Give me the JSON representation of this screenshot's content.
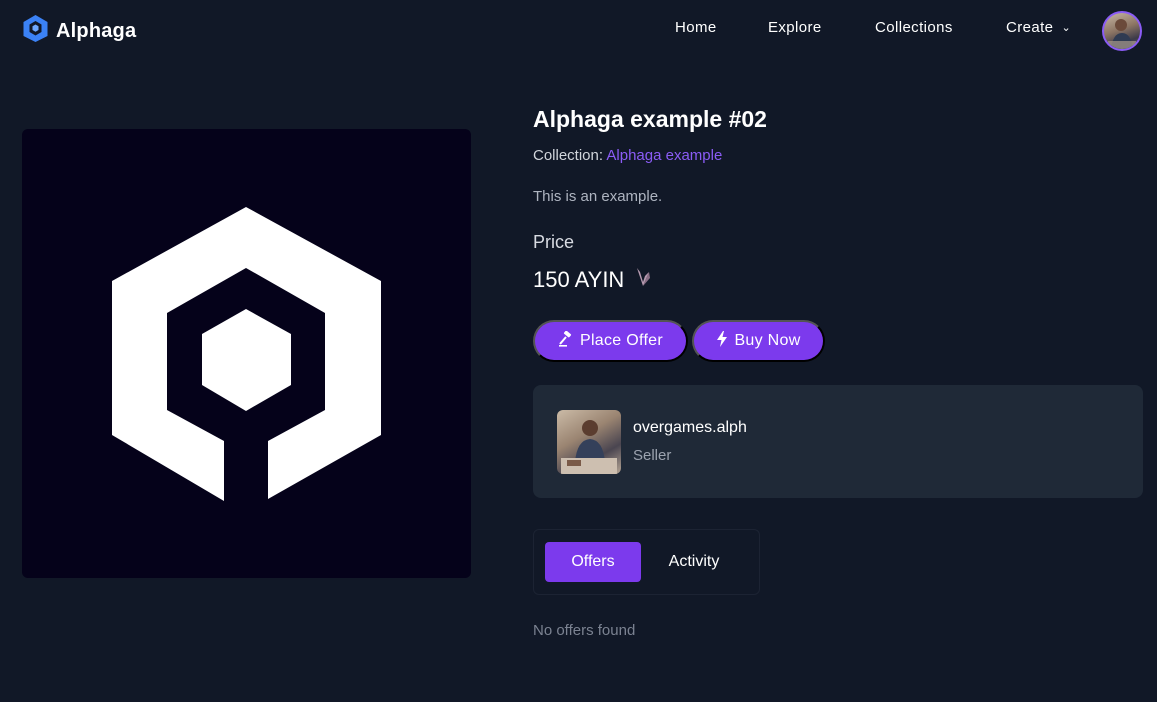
{
  "app": {
    "brand": "Alphaga"
  },
  "nav": {
    "items": [
      {
        "label": "Home"
      },
      {
        "label": "Explore"
      },
      {
        "label": "Collections"
      },
      {
        "label": "Create"
      }
    ]
  },
  "item": {
    "title": "Alphaga example #02",
    "collection_prefix": "Collection:",
    "collection_name": "Alphaga example",
    "description": "This is an example.",
    "price_label": "Price",
    "price_value": "150 AYIN"
  },
  "actions": {
    "place_offer": "Place Offer",
    "buy_now": "Buy Now"
  },
  "seller": {
    "name": "overgames.alph",
    "role": "Seller"
  },
  "tabs": [
    {
      "label": "Offers",
      "active": true
    },
    {
      "label": "Activity",
      "active": false
    }
  ],
  "offers": {
    "empty_text": "No offers found"
  },
  "colors": {
    "background": "#111827",
    "card": "#1f2937",
    "accent": "#7c3aed",
    "link": "#8b5cf6",
    "nft_background": "#05021a"
  },
  "icons": {
    "brand": "alphaga-logo-icon",
    "currency": "ayin-token-icon",
    "offer": "gavel-icon",
    "buy": "lightning-icon",
    "dropdown": "chevron-down-icon"
  }
}
